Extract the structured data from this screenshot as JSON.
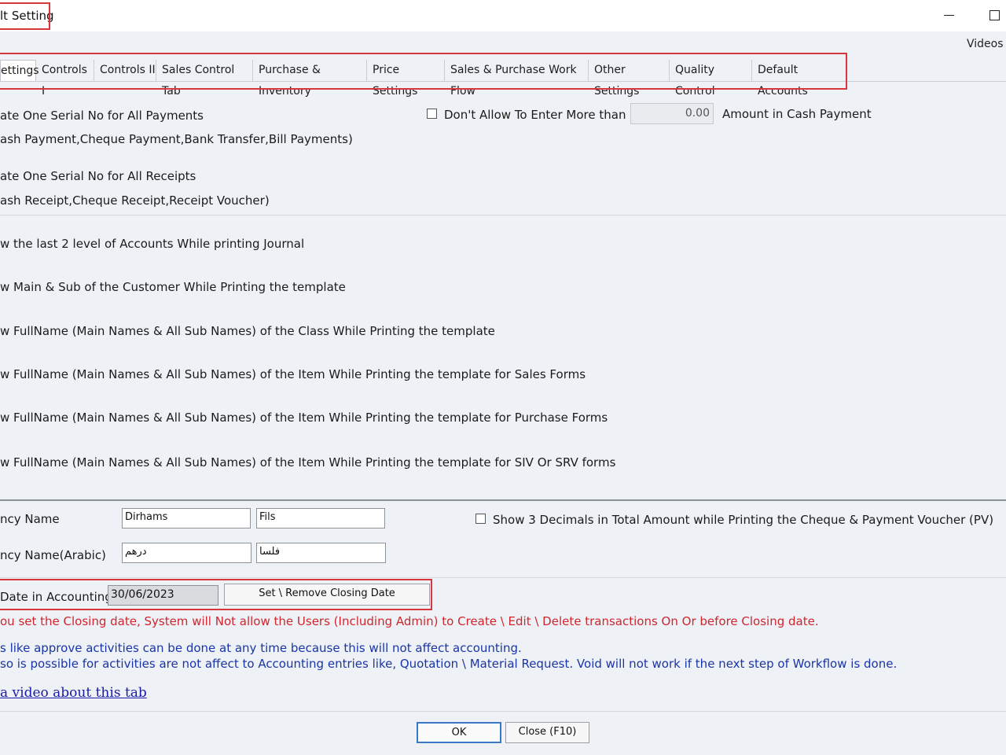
{
  "window": {
    "title": "lt Setting"
  },
  "header": {
    "videos_label": "Videos"
  },
  "tabs": [
    {
      "label": "ettings",
      "active": true
    },
    {
      "label": "Controls I"
    },
    {
      "label": "Controls II"
    },
    {
      "label": "Sales Control Tab"
    },
    {
      "label": "Purchase & Inventory"
    },
    {
      "label": "Price Settings"
    },
    {
      "label": "Sales & Purchase Work Flow"
    },
    {
      "label": "Other Settings"
    },
    {
      "label": "Quality Control"
    },
    {
      "label": "Default Accounts"
    }
  ],
  "serials": {
    "payments_label": "ate One Serial No for All Payments",
    "payments_detail": "ash Payment,Cheque Payment,Bank Transfer,Bill Payments)",
    "receipts_label": "ate One Serial No for All Receipts",
    "receipts_detail": "ash Receipt,Cheque Receipt,Receipt Voucher)"
  },
  "cash_limit": {
    "checkbox_label": "Don't Allow To Enter More than",
    "value": "0.00",
    "suffix": "Amount in Cash Payment"
  },
  "print_options": [
    "w the last 2 level of Accounts While printing Journal",
    "w Main & Sub of the Customer While Printing the template",
    "w FullName (Main Names & All Sub Names) of the Class While Printing the template",
    "w FullName (Main Names & All Sub Names) of the Item While Printing the template for Sales Forms",
    "w FullName (Main Names & All Sub Names) of the Item While Printing the template for Purchase Forms",
    "w FullName (Main Names & All Sub Names) of the Item While Printing the template for SIV Or SRV forms"
  ],
  "currency": {
    "name_label": "ncy Name",
    "main_value": "Dirhams",
    "sub_value": "Fils",
    "arabic_label": "ncy Name(Arabic)",
    "arabic_main_value": "درهم",
    "arabic_sub_value": "فلسا",
    "decimals_label": "Show 3 Decimals in Total Amount while Printing the Cheque & Payment Voucher (PV)"
  },
  "closing": {
    "label": "Date in Accounting",
    "date_value": "30/06/2023",
    "button_label": "Set \\ Remove Closing Date",
    "warning": "ou set the Closing date, System will Not allow the Users (Including Admin)  to Create \\ Edit \\ Delete transactions On Or before Closing date.",
    "note1": "s like approve activities can be done at any time because this will not affect accounting.",
    "note2": "so is possible for activities are not affect to Accounting entries like, Quotation \\ Material Request. Void will not work if the next step of Workflow is done.",
    "video_link": "a video about this tab"
  },
  "footer": {
    "ok_label": "OK",
    "close_label": "Close (F10)"
  },
  "colors": {
    "highlight_border": "#d7363d",
    "warning_text": "#d0262e",
    "note_text": "#1a35a8"
  }
}
